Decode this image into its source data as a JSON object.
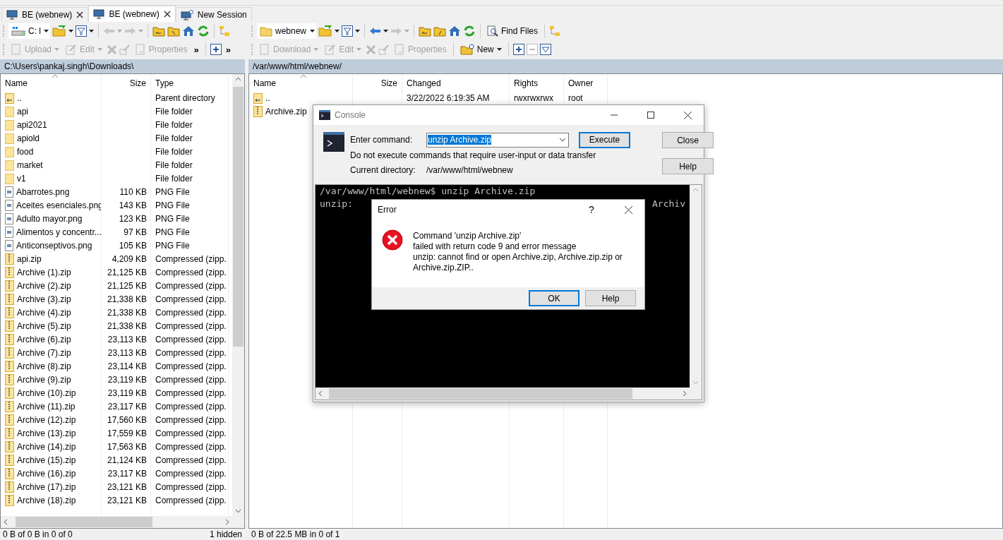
{
  "tabs": [
    {
      "label": "BE (webnew)",
      "selected": false,
      "kind": "session"
    },
    {
      "label": "BE (webnew)",
      "selected": true,
      "kind": "session"
    },
    {
      "label": "New Session",
      "selected": false,
      "kind": "new"
    }
  ],
  "left": {
    "drive": "C: l",
    "actions": [
      {
        "label": "Upload",
        "disabled": true,
        "kind": "upload"
      },
      {
        "label": "Edit",
        "disabled": true,
        "kind": "edit"
      },
      {
        "label": "Properties",
        "disabled": true,
        "kind": "properties"
      }
    ],
    "overflow": [
      "»",
      "»"
    ],
    "path": "C:\\Users\\pankaj.singh\\Downloads\\",
    "columns": [
      "Name",
      "Size",
      "Type"
    ],
    "rows": [
      {
        "name": "..",
        "type": "Parent directory",
        "kind": "parent"
      },
      {
        "name": "api",
        "type": "File folder",
        "kind": "folder"
      },
      {
        "name": "api2021",
        "type": "File folder",
        "kind": "folder"
      },
      {
        "name": "apiold",
        "type": "File folder",
        "kind": "folder"
      },
      {
        "name": "food",
        "type": "File folder",
        "kind": "folder"
      },
      {
        "name": "market",
        "type": "File folder",
        "kind": "folder"
      },
      {
        "name": "v1",
        "type": "File folder",
        "kind": "folder"
      },
      {
        "name": "Abarrotes.png",
        "size": "110 KB",
        "type": "PNG File",
        "kind": "image"
      },
      {
        "name": "Aceites esenciales.png",
        "size": "143 KB",
        "type": "PNG File",
        "kind": "image"
      },
      {
        "name": "Adulto mayor.png",
        "size": "123 KB",
        "type": "PNG File",
        "kind": "image"
      },
      {
        "name": "Alimentos y concentr...",
        "size": "97 KB",
        "type": "PNG File",
        "kind": "image"
      },
      {
        "name": "Anticonseptivos.png",
        "size": "105 KB",
        "type": "PNG File",
        "kind": "image"
      },
      {
        "name": "api.zip",
        "size": "4,209 KB",
        "type": "Compressed (zipp.",
        "kind": "zip"
      },
      {
        "name": "Archive (1).zip",
        "size": "21,125 KB",
        "type": "Compressed (zipp.",
        "kind": "zip"
      },
      {
        "name": "Archive (2).zip",
        "size": "21,125 KB",
        "type": "Compressed (zipp.",
        "kind": "zip"
      },
      {
        "name": "Archive (3).zip",
        "size": "21,338 KB",
        "type": "Compressed (zipp.",
        "kind": "zip"
      },
      {
        "name": "Archive (4).zip",
        "size": "21,338 KB",
        "type": "Compressed (zipp.",
        "kind": "zip"
      },
      {
        "name": "Archive (5).zip",
        "size": "21,338 KB",
        "type": "Compressed (zipp.",
        "kind": "zip"
      },
      {
        "name": "Archive (6).zip",
        "size": "23,113 KB",
        "type": "Compressed (zipp.",
        "kind": "zip"
      },
      {
        "name": "Archive (7).zip",
        "size": "23,113 KB",
        "type": "Compressed (zipp.",
        "kind": "zip"
      },
      {
        "name": "Archive (8).zip",
        "size": "23,114 KB",
        "type": "Compressed (zipp.",
        "kind": "zip"
      },
      {
        "name": "Archive (9).zip",
        "size": "23,119 KB",
        "type": "Compressed (zipp.",
        "kind": "zip"
      },
      {
        "name": "Archive (10).zip",
        "size": "23,119 KB",
        "type": "Compressed (zipp.",
        "kind": "zip"
      },
      {
        "name": "Archive (11).zip",
        "size": "23,117 KB",
        "type": "Compressed (zipp.",
        "kind": "zip"
      },
      {
        "name": "Archive (12).zip",
        "size": "17,560 KB",
        "type": "Compressed (zipp.",
        "kind": "zip"
      },
      {
        "name": "Archive (13).zip",
        "size": "17,559 KB",
        "type": "Compressed (zipp.",
        "kind": "zip"
      },
      {
        "name": "Archive (14).zip",
        "size": "17,563 KB",
        "type": "Compressed (zipp.",
        "kind": "zip"
      },
      {
        "name": "Archive (15).zip",
        "size": "21,124 KB",
        "type": "Compressed (zipp.",
        "kind": "zip"
      },
      {
        "name": "Archive (16).zip",
        "size": "23,117 KB",
        "type": "Compressed (zipp.",
        "kind": "zip"
      },
      {
        "name": "Archive (17).zip",
        "size": "23,121 KB",
        "type": "Compressed (zipp.",
        "kind": "zip"
      },
      {
        "name": "Archive (18).zip",
        "size": "23,121 KB",
        "type": "Compressed (zipp.",
        "kind": "zip"
      }
    ],
    "status": {
      "selection": "0 B of 0 B in 0 of 0",
      "hidden": "1 hidden"
    }
  },
  "right": {
    "location": "webnew",
    "find": "Find Files",
    "actions": [
      {
        "label": "Download",
        "disabled": true,
        "kind": "download"
      },
      {
        "label": "Edit",
        "disabled": true,
        "kind": "edit"
      },
      {
        "label": "Properties",
        "disabled": true,
        "kind": "properties"
      },
      {
        "label": "New",
        "disabled": false,
        "kind": "new"
      }
    ],
    "path": "/var/www/html/webnew/",
    "columns": [
      "Name",
      "Size",
      "Changed",
      "Rights",
      "Owner"
    ],
    "rows": [
      {
        "name": "..",
        "kind": "parent",
        "changed": "3/22/2022 6:19:35 AM",
        "rights": "rwxrwxrwx",
        "owner": "root"
      },
      {
        "name": "Archive.zip",
        "kind": "zip"
      }
    ],
    "status": {
      "selection": "0 B of 22.5 MB in 0 of 1"
    }
  },
  "console": {
    "title": "Console",
    "command_label": "Enter command:",
    "command": "unzip Archive.zip",
    "command_selected": true,
    "warning": "Do not execute commands that require user-input or data transfer",
    "directory_label": "Current directory:",
    "directory": "/var/www/html/webnew",
    "buttons": [
      {
        "label": "Execute",
        "default": true
      },
      {
        "label": "Close",
        "default": false
      },
      {
        "label": "Help",
        "default": false
      }
    ],
    "terminal": {
      "lines": [
        "/var/www/html/webnew$ unzip Archive.zip"
      ],
      "cut_line_start": "unzip:",
      "cut_line_end": "Archiv"
    }
  },
  "error": {
    "title": "Error",
    "help_mark": "?",
    "message": [
      "Command 'unzip Archive.zip'",
      "failed with return code 9 and error message",
      "unzip:  cannot find or open Archive.zip, Archive.zip.zip or",
      "Archive.zip.ZIP.."
    ],
    "buttons": [
      {
        "label": "OK",
        "default": true
      },
      {
        "label": "Help",
        "default": false
      }
    ]
  }
}
